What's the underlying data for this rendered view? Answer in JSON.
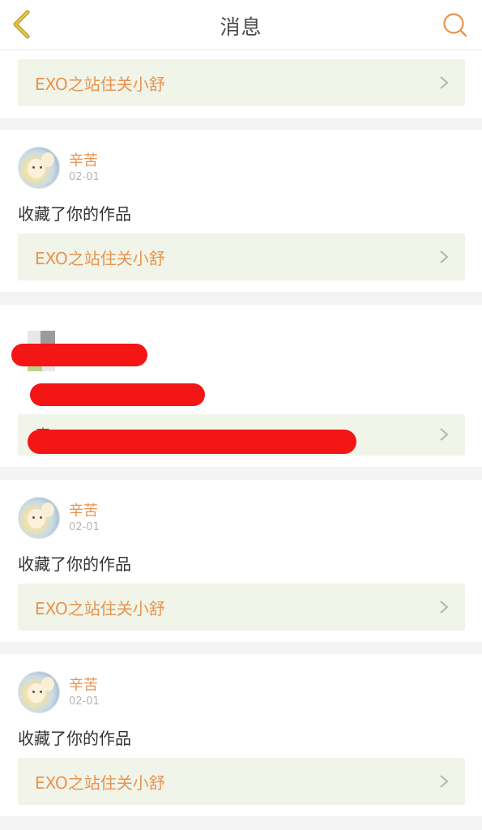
{
  "header": {
    "title": "消息",
    "back_icon": "chevron-left-icon",
    "search_icon": "search-icon"
  },
  "colors": {
    "accent": "#e8934e",
    "link_bg": "#f1f4e8",
    "redaction": "#f41515"
  },
  "top_link": {
    "label": "EXO之站住关小舒"
  },
  "notifications": [
    {
      "username": "辛苦",
      "date": "02-01",
      "action": "收藏了你的作品",
      "work": "EXO之站住关小舒"
    },
    {
      "redacted": true,
      "partial_text": "喜"
    },
    {
      "username": "辛苦",
      "date": "02-01",
      "action": "收藏了你的作品",
      "work": "EXO之站住关小舒"
    },
    {
      "username": "辛苦",
      "date": "02-01",
      "action": "收藏了你的作品",
      "work": "EXO之站住关小舒"
    }
  ]
}
